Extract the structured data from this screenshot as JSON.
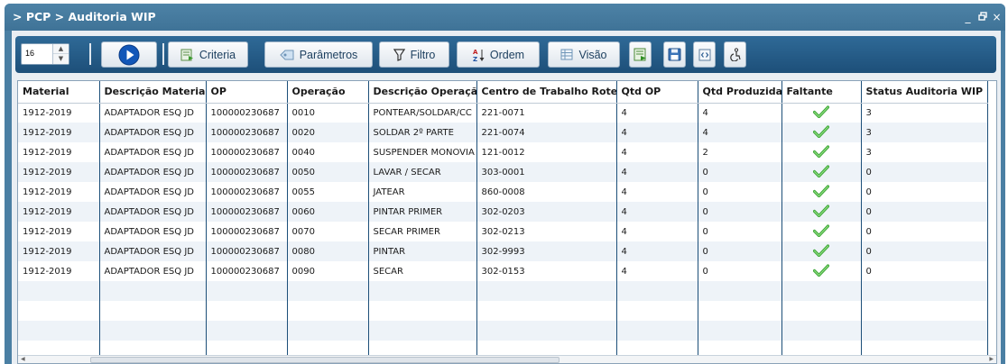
{
  "window": {
    "title": "> PCP > Auditoria WIP",
    "controls": {
      "minimize": "_",
      "restore": "🗗",
      "close": "×"
    }
  },
  "toolbar": {
    "page_size_value": "16",
    "buttons": {
      "criteria": "Criteria",
      "parametros": "Parâmetros",
      "filtro": "Filtro",
      "ordem": "Ordem",
      "visao": "Visão"
    },
    "icons": {
      "run": "play-icon",
      "criteria": "criteria-icon",
      "parametros": "tag-icon",
      "filtro": "filter-icon",
      "ordem": "sort-az-icon",
      "visao": "grid-view-icon",
      "export": "export-excel-icon",
      "save": "save-icon",
      "code": "code-icon",
      "wheelchair": "accessibility-icon"
    }
  },
  "grid": {
    "columns": [
      "Material",
      "Descrição Material",
      "OP",
      "Operação",
      "Descrição Operação",
      "Centro de Trabalho Roteiro",
      "Qtd OP",
      "Qtd Produzida",
      "Faltante",
      "Status Auditoria WIP"
    ],
    "rows": [
      [
        "1912-2019",
        "ADAPTADOR ESQ JD",
        "100000230687",
        "0010",
        "PONTEAR/SOLDAR/CC",
        "221-0071",
        "4",
        "4",
        "check",
        "3"
      ],
      [
        "1912-2019",
        "ADAPTADOR ESQ JD",
        "100000230687",
        "0020",
        "SOLDAR 2º PARTE",
        "221-0074",
        "4",
        "4",
        "check",
        "3"
      ],
      [
        "1912-2019",
        "ADAPTADOR ESQ JD",
        "100000230687",
        "0040",
        "SUSPENDER MONOVIA",
        "121-0012",
        "4",
        "2",
        "check",
        "3"
      ],
      [
        "1912-2019",
        "ADAPTADOR ESQ JD",
        "100000230687",
        "0050",
        "LAVAR / SECAR",
        "303-0001",
        "4",
        "0",
        "check",
        "0"
      ],
      [
        "1912-2019",
        "ADAPTADOR ESQ JD",
        "100000230687",
        "0055",
        "JATEAR",
        "860-0008",
        "4",
        "0",
        "check",
        "0"
      ],
      [
        "1912-2019",
        "ADAPTADOR ESQ JD",
        "100000230687",
        "0060",
        "PINTAR PRIMER",
        "302-0203",
        "4",
        "0",
        "check",
        "0"
      ],
      [
        "1912-2019",
        "ADAPTADOR ESQ JD",
        "100000230687",
        "0070",
        "SECAR PRIMER",
        "302-0213",
        "4",
        "0",
        "check",
        "0"
      ],
      [
        "1912-2019",
        "ADAPTADOR ESQ JD",
        "100000230687",
        "0080",
        "PINTAR",
        "302-9993",
        "4",
        "0",
        "check",
        "0"
      ],
      [
        "1912-2019",
        "ADAPTADOR ESQ JD",
        "100000230687",
        "0090",
        "SECAR",
        "302-0153",
        "4",
        "0",
        "check",
        "0"
      ]
    ],
    "empty_rows": 4
  },
  "colors": {
    "titlebar": "#4a7fa3",
    "toolbar": "#1d4f79",
    "accent_play": "#1565c0",
    "check_green": "#4caf50",
    "row_alt": "#eef3f8"
  }
}
